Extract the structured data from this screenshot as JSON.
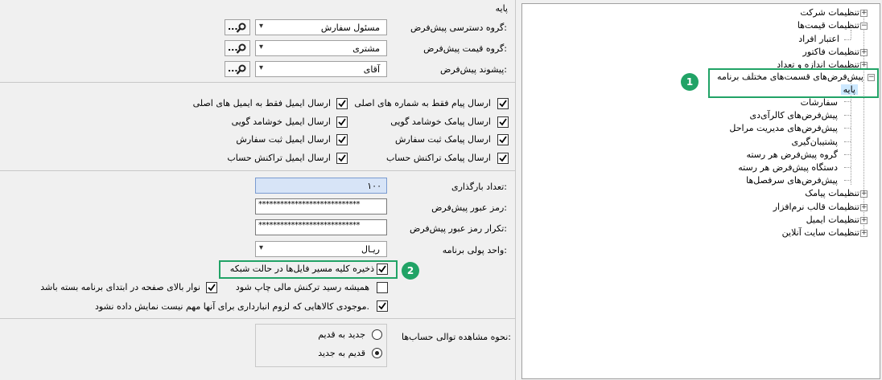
{
  "left": {
    "section_title": "پایه",
    "rows": [
      {
        "label": "گروه دسترسی پیش‌فرض:",
        "value": "مسئول سفارش",
        "button_dots": "..."
      },
      {
        "label": "گروه قیمت پیش‌فرض:",
        "value": "مشتری",
        "button_dots": "..."
      },
      {
        "label": "پیشوند پیش‌فرض:",
        "value": "آقای",
        "button_dots": "..."
      }
    ],
    "checks": {
      "c1": {
        "label": "ارسال پیام فقط به شماره های اصلی",
        "checked": true
      },
      "c2": {
        "label": "ارسال ایمیل فقط به ایمیل های اصلی",
        "checked": true
      },
      "c3": {
        "label": "ارسال پیامک خوشامد گویی",
        "checked": true
      },
      "c4": {
        "label": "ارسال ایمیل خوشامد گویی",
        "checked": true
      },
      "c5": {
        "label": "ارسال پیامک ثبت سفارش",
        "checked": true
      },
      "c6": {
        "label": "ارسال ایمیل ثبت سفارش",
        "checked": true
      },
      "c7": {
        "label": "ارسال پیامک تراکنش حساب",
        "checked": true
      },
      "c8": {
        "label": "ارسال ایمیل تراکنش حساب",
        "checked": true
      }
    },
    "load_count_label": "تعداد بارگذاری:",
    "load_count_value": "۱۰۰",
    "password_label": "رمز عبور پیش‌فرض:",
    "password_value": "****************************",
    "password_repeat_label": "تکرار رمز عبور پیش‌فرض:",
    "password_repeat_value": "****************************",
    "currency_label": "واحد پولی برنامه:",
    "currency_value": "ریـال",
    "save_paths_label": "ذخیره کلیه مسیر فایل‌ها در حالت شبکه",
    "always_print_label": "همیشه رسید ترکنش مالی چاپ شود",
    "top_bar_label": "نوار بالای صفحه در ابتدای برنامه بسته باشد",
    "inventory_label": "موجودی کالاهایی که لزوم انبارداری برای آنها مهم نیست نمایش داده نشود.",
    "account_order_label": "نحوه مشاهده توالی حساب‌ها:",
    "radio_new_to_old": "جدید به قدیم",
    "radio_old_to_new": "قدیم به جدید",
    "badge2": "2"
  },
  "tree": {
    "company": "تنظیمات شرکت",
    "prices": "تنظیمات قیمت‌ها",
    "credit": "اعتبار افراد",
    "invoice": "تنظیمات فاکتور",
    "size": "تنظیمات اندازه و تعداد",
    "defaults": "پیش‌فرض‌های قسمت‌های مختلف برنامه",
    "base": "پایه",
    "orders": "سفارشات",
    "goods": "پیش‌فرض‌های کالرآی‌دی",
    "stages": "پیش‌فرض‌های مدیریت مراحل",
    "backup": "پشتیبان‌گیری",
    "group_default": "گروه پیش‌فرض هر رسته",
    "device_default": "دستگاه پیش‌فرض هر رسته",
    "headings": "پیش‌فرض‌های سرفصل‌ها",
    "sms": "تنظیمات پیامک",
    "template": "تنظیمات قالب نرم‌افزار",
    "email": "تنظیمات ایمیل",
    "online": "تنظیمات سایت آنلاین",
    "badge1": "1"
  },
  "colors": {
    "accent": "#21a366",
    "selection": "#cce8ff"
  },
  "icons": [
    "search-icon",
    "chevron-down-icon",
    "check-icon",
    "plus-icon",
    "minus-icon"
  ]
}
